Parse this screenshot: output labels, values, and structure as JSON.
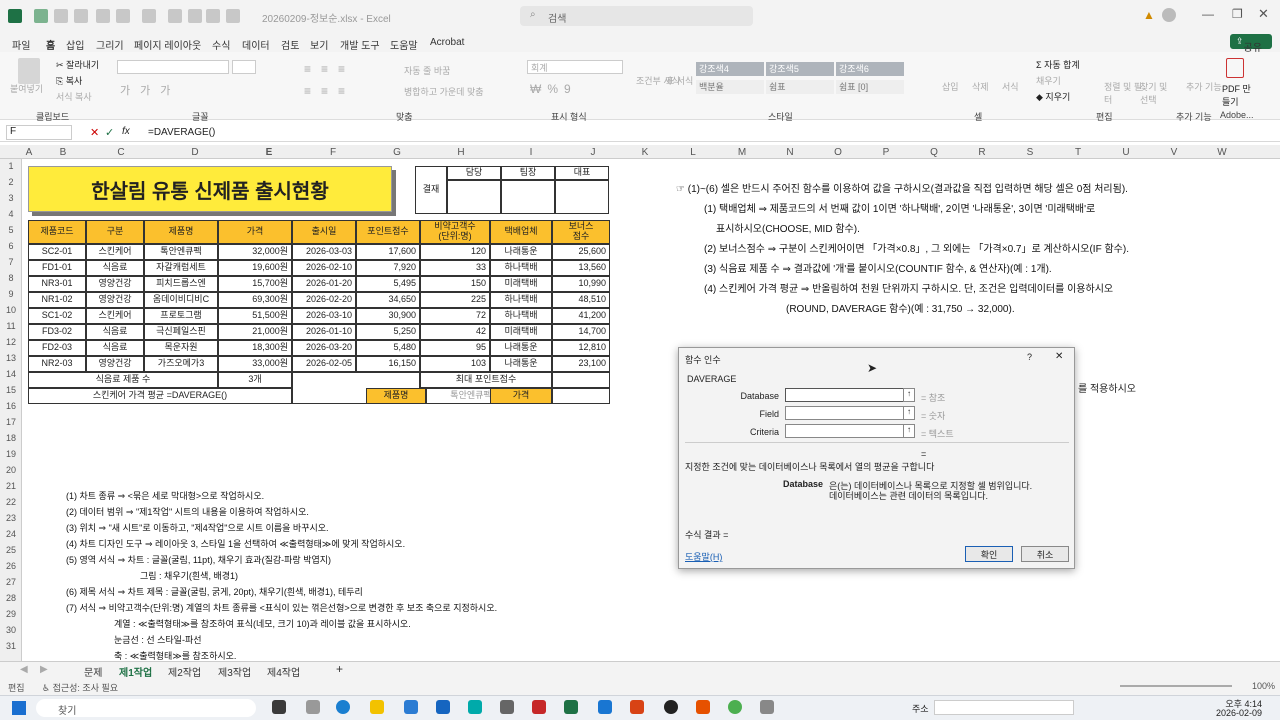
{
  "title": {
    "file": "20260209-정보순.xlsx - Excel",
    "search": "검색"
  },
  "menu": [
    "파일",
    "홈",
    "삽입",
    "그리기",
    "페이지 레이아웃",
    "수식",
    "데이터",
    "검토",
    "보기",
    "개발 도구",
    "도움말",
    "Acrobat"
  ],
  "share": "공유",
  "ribbon": {
    "clipboard": [
      "붙여넣기",
      "잘라내기",
      "복사",
      "서식 복사"
    ],
    "groups": [
      "클립보드",
      "글꼴",
      "맞춤",
      "표시 형식",
      "스타일",
      "셀",
      "편집",
      "추가 기능",
      "Adobe..."
    ],
    "wrap": "자동 줄 바꿈",
    "merge": "병합하고 가운데 맞춤",
    "number": "회계",
    "styles": [
      "강조색4",
      "강조색5",
      "강조색6",
      "백분율",
      "쉼표",
      "쉼표 [0]"
    ],
    "cond": [
      "조건부 서식",
      "표 서식"
    ],
    "cells": [
      "삽입",
      "삭제",
      "서식"
    ],
    "edit": [
      "자동 합계",
      "채우기",
      "지우기",
      "정렬 및 필터",
      "찾기 및 선택"
    ],
    "addin": "추가 기능",
    "pdf": "PDF 만들기"
  },
  "formula": {
    "namebox": "F",
    "fx": "fx",
    "content": "=DAVERAGE()"
  },
  "columns": [
    "A",
    "B",
    "C",
    "D",
    "E",
    "F",
    "G",
    "H",
    "I",
    "J",
    "K",
    "L",
    "M",
    "N",
    "O",
    "P",
    "Q",
    "R",
    "S",
    "T",
    "U",
    "V",
    "W"
  ],
  "rows": [
    "1",
    "2",
    "3",
    "4",
    "5",
    "6",
    "7",
    "8",
    "9",
    "10",
    "11",
    "12",
    "13",
    "14",
    "15",
    "16",
    "17",
    "18",
    "19",
    "20",
    "21",
    "22",
    "23",
    "24",
    "25",
    "26",
    "27",
    "28",
    "29",
    "30",
    "31"
  ],
  "sheet": {
    "banner": "한살림 유통 신제품 출시현황",
    "approval": {
      "label": "결재",
      "cols": [
        "담당",
        "팀장",
        "대표"
      ]
    },
    "headers": [
      "제품코드",
      "구분",
      "제품명",
      "가격",
      "출시일",
      "포인트점수",
      "비약고객수\n(단위:명)",
      "택배업체",
      "보너스\n점수"
    ],
    "rows": [
      [
        "SC2-01",
        "스킨케어",
        "톡안엔큐펙",
        "32,000원",
        "2026-03-03",
        "17,600",
        "120",
        "나래통운",
        "25,600"
      ],
      [
        "FD1-01",
        "식음료",
        "자갈캐럼세트",
        "19,600원",
        "2026-02-10",
        "7,920",
        "33",
        "하나택배",
        "13,560"
      ],
      [
        "NR3-01",
        "영양건강",
        "피치드롭스엔",
        "15,700원",
        "2026-01-20",
        "5,495",
        "150",
        "미래택배",
        "10,990"
      ],
      [
        "NR1-02",
        "영양건강",
        "옴데이비디비C",
        "69,300원",
        "2026-02-20",
        "34,650",
        "225",
        "하나택배",
        "48,510"
      ],
      [
        "SC1-02",
        "스킨케어",
        "프로토그램",
        "51,500원",
        "2026-03-10",
        "30,900",
        "72",
        "하나택배",
        "41,200"
      ],
      [
        "FD3-02",
        "식음료",
        "극신페일스핀",
        "21,000원",
        "2026-01-10",
        "5,250",
        "42",
        "미래택배",
        "14,700"
      ],
      [
        "FD2-03",
        "식음료",
        "목운자원",
        "18,300원",
        "2026-03-20",
        "5,480",
        "95",
        "나래통운",
        "12,810"
      ],
      [
        "NR2-03",
        "영양건강",
        "가즈오메가3",
        "33,000원",
        "2026-02-05",
        "16,150",
        "103",
        "나래통운",
        "23,100"
      ]
    ],
    "r13": {
      "a": "식음료 제품 수",
      "b": "3개",
      "c": "최대 포인트점수"
    },
    "r14": {
      "a": "스킨케어 가격 평균",
      "b": "=DAVERAGE()",
      "c": "제품명",
      "d": "톡안엔큐펙",
      "e": "가격"
    }
  },
  "notes": [
    "☞ (1)~(6) 셀은 반드시 주어진 함수를 이용하여 값을 구하시오(결과값을 직접 입력하면 해당 셀은 0점 처리됨).",
    "(1) 택배업체 ⇒ 제품코드의 서 번째 값이 1이면 '하나택배', 2이면 '나래통운', 3이면 '미래택배'로",
    "표시하시오(CHOOSE, MID 함수).",
    "(2) 보너스점수 ⇒ 구분이 스킨케어이면 「가격×0.8」, 그 외에는 「가격×0.7」로 계산하시오(IF 함수).",
    "(3) 식음료 제품 수 ⇒ 결과값에 '개'를 붙이시오(COUNTIF 함수, & 연산자)(예 : 1개).",
    "(4) 스킨케어 가격 평균 ⇒ 반올림하여 천원 단위까지 구하시오. 단, 조건은 입력데이터를 이용하시오",
    "(ROUND, DAVERAGE 함수)(예 : 31,750 → 32,000)."
  ],
  "notes_tail": "를 적용하시오",
  "chart_notes": [
    "(1) 차트 종류 ⇒ <묶은 세로 막대형>으로 작업하시오.",
    "(2) 데이터 범위 ⇒ \"제1작업\" 시트의 내용을 이용하여 작업하시오.",
    "(3) 위치 ⇒ \"새 시트\"로 이동하고, \"제4작업\"으로 시트 이름을 바꾸시오.",
    "(4) 차트 디자인 도구 ⇒ 레이아웃 3, 스타일 1을 선택하여 ≪출력형태≫에 맞게 작업하시오.",
    "(5) 영역 서식 ⇒ 차트 : 글꼴(굴림, 11pt), 채우기 효과(질감-파랑 박엽지)",
    "그림 : 채우기(흰색, 배경1)",
    "(6) 제목 서식 ⇒ 차트 제목 : 글꼴(굴림, 굵게, 20pt), 채우기(흰색, 배경1), 테두리",
    "(7) 서식 ⇒ 비약고객수(단위:명) 계열의 차트 종류를 <표식이 있는 꺾은선형>으로 변경한 후 보조 축으로 지정하시오.",
    "계열 : ≪출력형태≫를 참조하여 표식(네모, 크기 10)과 레이블 값을 표시하시오.",
    "눈금선 : 선 스타일-파선",
    "축 : ≪출력형태≫를 참조하시오."
  ],
  "dialog": {
    "title": "함수 인수",
    "help": "?",
    "close": "✕",
    "func": "DAVERAGE",
    "fields": [
      {
        "label": "Database",
        "hint": "참조"
      },
      {
        "label": "Field",
        "hint": "숫자"
      },
      {
        "label": "Criteria",
        "hint": "텍스트"
      }
    ],
    "equals": "=",
    "desc": "지정한 조건에 맞는 데이터베이스나 목록에서 열의 평균을 구합니다",
    "arg_name": "Database",
    "arg_desc1": "은(는) 데이터베이스나 목록으로 지정할 셀 범위입니다.",
    "arg_desc2": "데이터베이스는 관련 데이터의 목록입니다.",
    "result": "수식 결과 =",
    "helplink": "도움말(H)",
    "ok": "확인",
    "cancel": "취소"
  },
  "tabs": [
    "문제",
    "제1작업",
    "제2작업",
    "제3작업",
    "제4작업"
  ],
  "status": {
    "mode": "편집",
    "access": "접근성: 조사 필요",
    "zoom": "100%"
  },
  "taskbar": {
    "search": "찾기",
    "address": "주소",
    "time": "오후 4:14",
    "date": "2026-02-09"
  }
}
